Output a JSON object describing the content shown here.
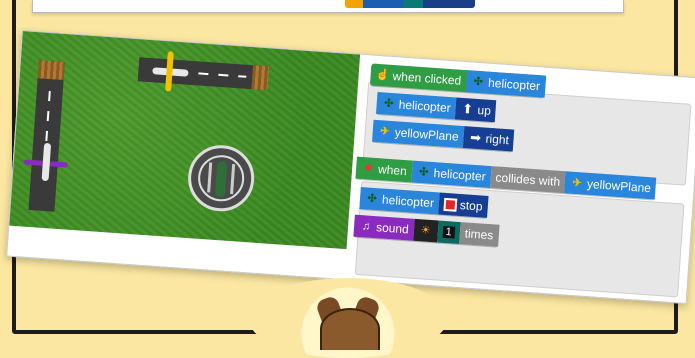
{
  "colors": {
    "background": "#fbe7a1",
    "event_green": "#2e9d44",
    "sprite_blue": "#2a86db",
    "action_dark_blue": "#163f94",
    "collide_grey": "#8a8a8a",
    "sound_purple": "#8a2bbd"
  },
  "game": {
    "sprites": [
      {
        "name": "helicopter",
        "icon": "helicopter-icon"
      },
      {
        "name": "yellowPlane",
        "icon": "yellow-plane-icon"
      },
      {
        "name": "purplePlane",
        "icon": "purple-plane-icon"
      }
    ]
  },
  "code": {
    "script1": {
      "event_label": "when clicked",
      "event_icon": "pointer-hand-icon",
      "target": "helicopter",
      "actions": [
        {
          "sprite": "helicopter",
          "direction_icon": "arrow-up-icon",
          "direction": "up"
        },
        {
          "sprite": "yellowPlane",
          "direction_icon": "arrow-right-icon",
          "direction": "right"
        }
      ]
    },
    "script2": {
      "event_icon": "collision-icon",
      "when_label": "when",
      "sprite_a": "helicopter",
      "collides_label": "collides with",
      "sprite_b": "yellowPlane",
      "actions": [
        {
          "sprite": "helicopter",
          "action_icon": "stop-icon",
          "action": "stop"
        },
        {
          "label": "sound",
          "sound_icon": "sound-icon",
          "effect_icon": "sun-icon",
          "count": "1",
          "times_label": "times"
        }
      ]
    }
  }
}
